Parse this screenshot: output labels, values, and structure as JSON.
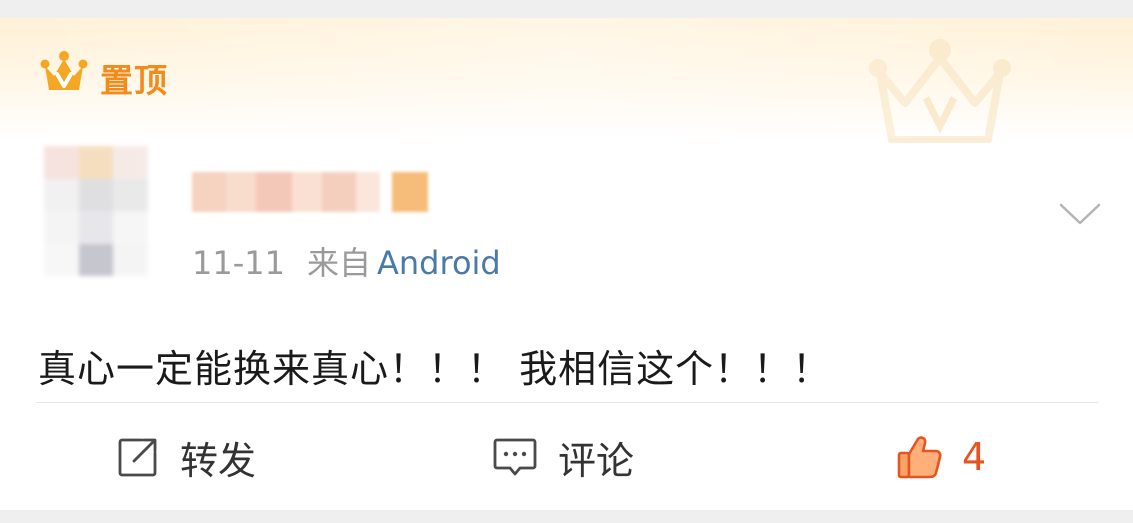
{
  "pin": {
    "label": "置顶",
    "icon": "crown-v-icon",
    "accent": "#f08b1c"
  },
  "post": {
    "date": "11-11",
    "from_label": "来自",
    "source": "Android",
    "text": "真心一定能换来真心！！！ 我相信这个！！！"
  },
  "actions": {
    "repost_label": "转发",
    "comment_label": "评论",
    "like_count": "4"
  },
  "colors": {
    "like": "#e8541f",
    "source_link": "#4a7aa8",
    "meta": "#9a9a9a"
  }
}
